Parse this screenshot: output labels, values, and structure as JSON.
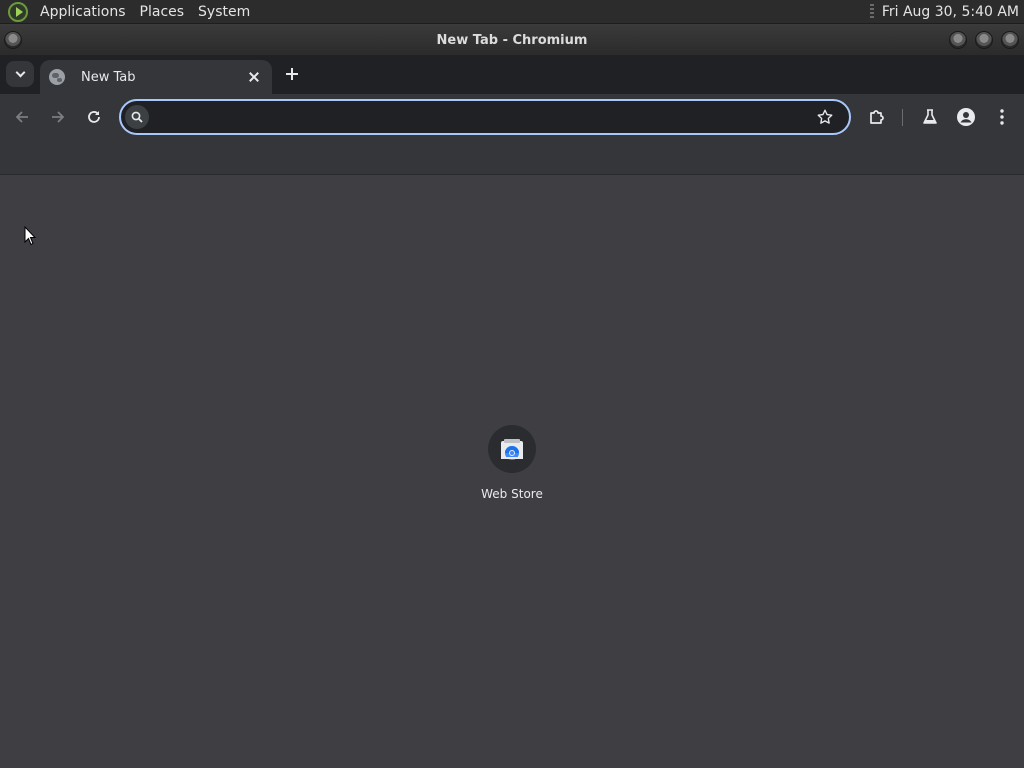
{
  "panel": {
    "menus": [
      "Applications",
      "Places",
      "System"
    ],
    "clock": "Fri Aug 30,  5:40 AM"
  },
  "window": {
    "title": "New Tab - Chromium"
  },
  "tabs": [
    {
      "label": "New Tab",
      "icon": "globe-icon",
      "active": true
    }
  ],
  "toolbar": {
    "back_icon": "arrow-left-icon",
    "forward_icon": "arrow-right-icon",
    "reload_icon": "reload-icon",
    "omnibox": {
      "value": "",
      "placeholder": ""
    },
    "bookmark_icon": "star-icon",
    "extensions_icon": "puzzle-icon",
    "labs_icon": "flask-icon",
    "profile_icon": "person-icon",
    "menu_icon": "kebab-icon"
  },
  "ntp": {
    "shortcuts": [
      {
        "label": "Web Store",
        "icon": "web-store-icon"
      }
    ]
  },
  "colors": {
    "accent_focus_ring": "#a8c7fa",
    "toolbar_bg": "#35363a",
    "page_bg": "#3f3f43",
    "tabstrip_bg": "#202124"
  }
}
